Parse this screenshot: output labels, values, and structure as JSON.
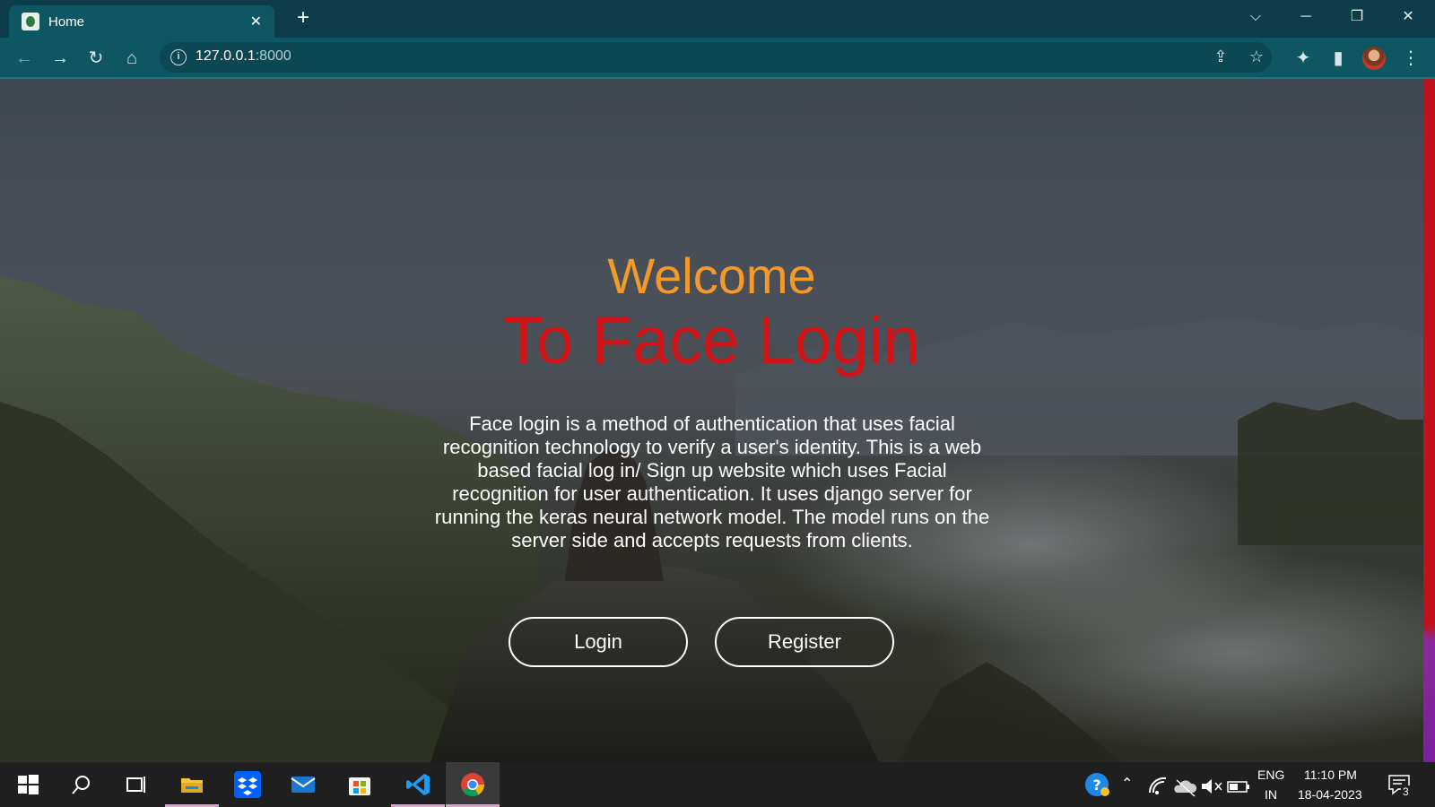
{
  "browser": {
    "tab_title": "Home",
    "tab_close": "✕",
    "new_tab": "+",
    "url_host": "127.0.0.1",
    "url_port": ":8000"
  },
  "page": {
    "welcome": "Welcome",
    "subtitle": "To Face Login",
    "description": "Face login is a method of authentication that uses facial recognition technology to verify a user's identity. This is a web based facial log in/ Sign up website which uses Facial recognition for user authentication. It uses django server for running the keras neural network model. The model runs on the server side and accepts requests from clients.",
    "login_label": "Login",
    "register_label": "Register"
  },
  "taskbar": {
    "language_top": "ENG",
    "language_bottom": "IN",
    "time": "11:10 PM",
    "date": "18-04-2023",
    "notification_count": "3"
  },
  "colors": {
    "welcome": "#f39a2b",
    "subtitle": "#d01418",
    "tabstrip": "#0d3d4b",
    "toolbar": "#0f5663"
  }
}
